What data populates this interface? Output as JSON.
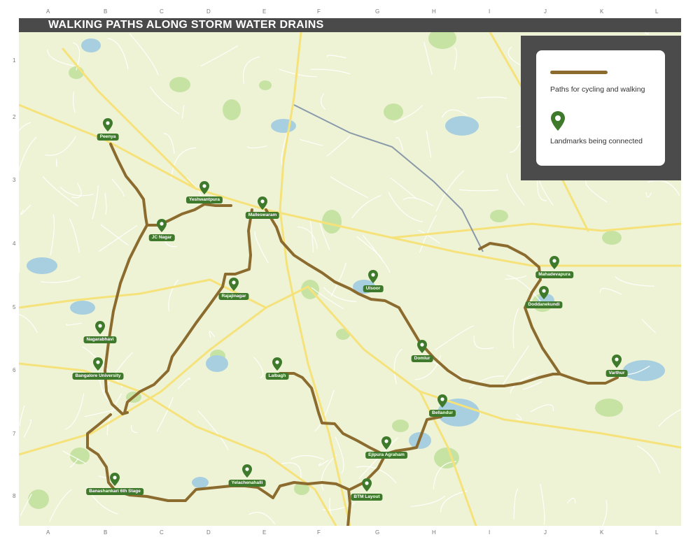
{
  "title": "WALKING PATHS ALONG STORM WATER DRAINS",
  "grid": {
    "columns": [
      "A",
      "B",
      "C",
      "D",
      "E",
      "F",
      "G",
      "H",
      "I",
      "J",
      "K",
      "L"
    ],
    "rows": [
      "1",
      "2",
      "3",
      "4",
      "5",
      "6",
      "7",
      "8"
    ]
  },
  "legend": {
    "path_label": "Paths for cycling and walking",
    "landmark_label": "Landmarks being connected",
    "path_color": "#8b6b2e",
    "marker_color": "#3f7a2c"
  },
  "landmarks": [
    {
      "name": "Peenya"
    },
    {
      "name": "Yeshwantpura"
    },
    {
      "name": "Malleswaram"
    },
    {
      "name": "JC Nagar"
    },
    {
      "name": "Rajajinagar"
    },
    {
      "name": "Ulsoor"
    },
    {
      "name": "Mahadevapura"
    },
    {
      "name": "Doddanekundi"
    },
    {
      "name": "Nagarabhavi"
    },
    {
      "name": "Bangalore University"
    },
    {
      "name": "Domlur"
    },
    {
      "name": "Varthur"
    },
    {
      "name": "Lalbagh"
    },
    {
      "name": "Bellandur"
    },
    {
      "name": "Ejipura Agraham"
    },
    {
      "name": "Banashankari 6th Stage"
    },
    {
      "name": "Yelachenahalli"
    },
    {
      "name": "BTM Layout"
    }
  ]
}
